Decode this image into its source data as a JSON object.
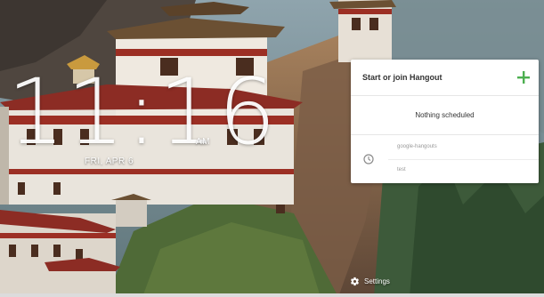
{
  "clock": {
    "time": "11:16",
    "ampm": "AM",
    "date": "FRI, APR 6"
  },
  "hangouts_card": {
    "title": "Start or join Hangout",
    "add_icon": "plus-icon",
    "empty_text": "Nothing scheduled",
    "event": {
      "icon": "clock-icon",
      "line1": "google-hangouts",
      "line2": "test"
    }
  },
  "settings": {
    "label": "Settings",
    "icon": "gear-icon"
  },
  "colors": {
    "accent_green": "#4caf50",
    "card_bg": "#ffffff",
    "title_text": "#333333",
    "muted_text": "#9a9a9a"
  }
}
